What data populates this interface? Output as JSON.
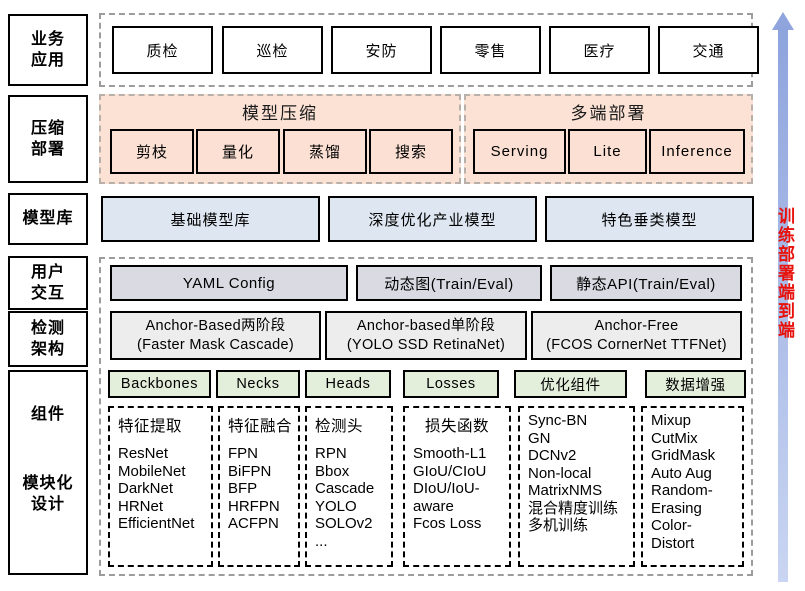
{
  "rows": {
    "business": {
      "label": "业务\n应用"
    },
    "compress": {
      "label": "压缩\n部署"
    },
    "modelzoo": {
      "label": "模型库"
    },
    "interaction": {
      "label": "用户\n交互"
    },
    "architecture": {
      "label": "检测\n架构"
    },
    "components": {
      "label_top": "组件",
      "label_bottom": "模块化\n设计"
    }
  },
  "business_apps": [
    "质检",
    "巡检",
    "安防",
    "零售",
    "医疗",
    "交通"
  ],
  "compression": {
    "title": "模型压缩",
    "items": [
      "剪枝",
      "量化",
      "蒸馏",
      "搜索"
    ]
  },
  "deployment": {
    "title": "多端部署",
    "items": [
      "Serving",
      "Lite",
      "Inference"
    ]
  },
  "model_zoo": [
    "基础模型库",
    "深度优化产业模型",
    "特色垂类模型"
  ],
  "user_interaction": [
    "YAML Config",
    "动态图(Train/Eval)",
    "静态API(Train/Eval)"
  ],
  "detection_architecture": [
    {
      "line1": "Anchor-Based两阶段",
      "line2": "(Faster  Mask  Cascade)"
    },
    {
      "line1": "Anchor-based单阶段",
      "line2": "(YOLO  SSD  RetinaNet)"
    },
    {
      "line1": "Anchor-Free",
      "line2": "(FCOS CornerNet TTFNet)"
    }
  ],
  "component_tags": [
    "Backbones",
    "Necks",
    "Heads",
    "Losses",
    "优化组件",
    "数据增强"
  ],
  "module_columns": [
    {
      "title": "特征提取",
      "items": [
        "ResNet",
        "MobileNet",
        "DarkNet",
        "HRNet",
        "EfficientNet"
      ]
    },
    {
      "title": "特征融合",
      "items": [
        "FPN",
        "BiFPN",
        "BFP",
        "HRFPN",
        "ACFPN"
      ]
    },
    {
      "title": "检测头",
      "items": [
        "RPN",
        "Bbox",
        "Cascade",
        "YOLO",
        "SOLOv2",
        "..."
      ]
    },
    {
      "title": "损失函数",
      "items": [
        "Smooth-L1",
        "GIoU/CIoU",
        "DIoU/IoU-",
        "aware",
        "Fcos Loss"
      ]
    },
    {
      "title": "",
      "items": [
        "Sync-BN",
        "GN",
        "DCNv2",
        "Non-local",
        "MatrixNMS",
        "混合精度训练",
        "多机训练"
      ]
    },
    {
      "title": "",
      "items": [
        "Mixup",
        "CutMix",
        "GridMask",
        "Auto Aug",
        "Random-",
        "Erasing",
        "Color-",
        "Distort"
      ]
    }
  ],
  "side_arrow": {
    "text": "训练部署端到端",
    "color": "#e8120c"
  },
  "colors": {
    "peach": "#fbe2d5",
    "blue": "#dee6f1",
    "lavender": "#d9dae2",
    "gray": "#ededed",
    "green": "#e3eedb",
    "arrow_top": "#8ea4dd",
    "arrow_bottom": "#c9d5f2"
  }
}
